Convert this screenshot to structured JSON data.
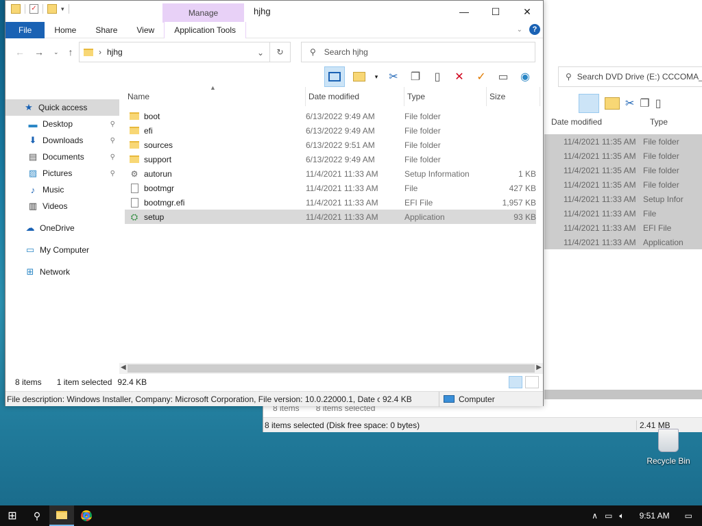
{
  "background_window": {
    "search_placeholder": "Search DVD Drive (E:) CCCOMA_",
    "columns": [
      "Date modified",
      "Type"
    ],
    "rows": [
      {
        "date": "11/4/2021 11:35 AM",
        "type": "File folder"
      },
      {
        "date": "11/4/2021 11:35 AM",
        "type": "File folder"
      },
      {
        "date": "11/4/2021 11:35 AM",
        "type": "File folder"
      },
      {
        "date": "11/4/2021 11:35 AM",
        "type": "File folder"
      },
      {
        "date": "11/4/2021 11:33 AM",
        "type": "Setup Infor"
      },
      {
        "date": "11/4/2021 11:33 AM",
        "type": "File"
      },
      {
        "date": "11/4/2021 11:33 AM",
        "type": "EFI File"
      },
      {
        "date": "11/4/2021 11:33 AM",
        "type": "Application"
      }
    ],
    "status_items": "8 items",
    "status_selected": "8 items selected",
    "status_bar_left": "8 items selected (Disk free space: 0 bytes)",
    "status_bar_right": "2.41 MB"
  },
  "window": {
    "title": "hjhg",
    "context_tab": "Manage",
    "tabs": {
      "file": "File",
      "home": "Home",
      "share": "Share",
      "view": "View",
      "app_tools": "Application Tools"
    },
    "controls": {
      "minimize": "—",
      "maximize": "☐",
      "close": "✕"
    },
    "address": "hjhg",
    "search_placeholder": "Search hjhg",
    "help": "?"
  },
  "nav": {
    "quick_access": "Quick access",
    "items": [
      {
        "label": "Desktop",
        "pinned": true
      },
      {
        "label": "Downloads",
        "pinned": true
      },
      {
        "label": "Documents",
        "pinned": true
      },
      {
        "label": "Pictures",
        "pinned": true
      },
      {
        "label": "Music",
        "pinned": false
      },
      {
        "label": "Videos",
        "pinned": false
      }
    ],
    "onedrive": "OneDrive",
    "my_computer": "My Computer",
    "network": "Network"
  },
  "columns": {
    "name": "Name",
    "date": "Date modified",
    "type": "Type",
    "size": "Size"
  },
  "files": [
    {
      "name": "boot",
      "date": "6/13/2022 9:49 AM",
      "type": "File folder",
      "size": "",
      "icon": "folder"
    },
    {
      "name": "efi",
      "date": "6/13/2022 9:49 AM",
      "type": "File folder",
      "size": "",
      "icon": "folder"
    },
    {
      "name": "sources",
      "date": "6/13/2022 9:51 AM",
      "type": "File folder",
      "size": "",
      "icon": "folder"
    },
    {
      "name": "support",
      "date": "6/13/2022 9:49 AM",
      "type": "File folder",
      "size": "",
      "icon": "folder"
    },
    {
      "name": "autorun",
      "date": "11/4/2021 11:33 AM",
      "type": "Setup Information",
      "size": "1 KB",
      "icon": "settings-file"
    },
    {
      "name": "bootmgr",
      "date": "11/4/2021 11:33 AM",
      "type": "File",
      "size": "427 KB",
      "icon": "file"
    },
    {
      "name": "bootmgr.efi",
      "date": "11/4/2021 11:33 AM",
      "type": "EFI File",
      "size": "1,957 KB",
      "icon": "file"
    },
    {
      "name": "setup",
      "date": "11/4/2021 11:33 AM",
      "type": "Application",
      "size": "93 KB",
      "icon": "installer",
      "selected": true
    }
  ],
  "status": {
    "count": "8 items",
    "selected": "1 item selected",
    "size": "92.4 KB"
  },
  "infobar": {
    "description": "File description: Windows Installer, Company: Microsoft Corporation, File version: 10.0.22000.1, Date cre",
    "size": "92.4 KB",
    "location": "Computer"
  },
  "desktop": {
    "recycle_bin": "Recycle Bin"
  },
  "taskbar": {
    "time": "9:51 AM"
  }
}
